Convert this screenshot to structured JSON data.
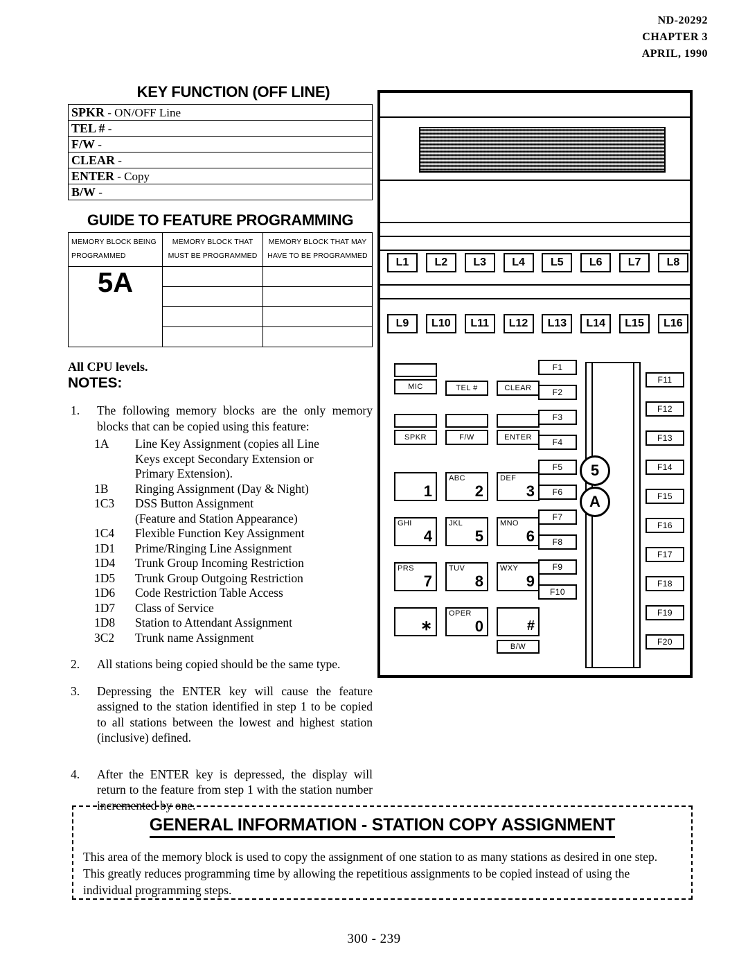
{
  "header": {
    "doc_id": "ND-20292",
    "chapter": "CHAPTER 3",
    "date": "APRIL, 1990"
  },
  "key_function": {
    "title": "KEY FUNCTION (OFF LINE)",
    "rows": [
      {
        "key": "SPKR",
        "value": "-  ON/OFF Line"
      },
      {
        "key": "TEL #",
        "value": "-"
      },
      {
        "key": "F/W",
        "value": "-"
      },
      {
        "key": "CLEAR",
        "value": "-"
      },
      {
        "key": "ENTER",
        "value": "- Copy"
      },
      {
        "key": "B/W",
        "value": "-"
      }
    ]
  },
  "guide": {
    "title": "GUIDE TO FEATURE PROGRAMMING",
    "headers": [
      {
        "line1": "MEMORY BLOCK BEING",
        "line2": "PROGRAMMED"
      },
      {
        "line1": "MEMORY BLOCK THAT",
        "line2": "MUST BE PROGRAMMED"
      },
      {
        "line1": "MEMORY BLOCK THAT MAY",
        "line2": "HAVE TO BE PROGRAMMED"
      }
    ],
    "memory_block": "5A",
    "empty_row_count": 4
  },
  "notes": {
    "cpu_levels": "All CPU levels.",
    "title": "NOTES:",
    "note1": {
      "num": "1.",
      "text": "The following memory blocks are the only memory blocks that can be copied using this feature:"
    },
    "memory_blocks": [
      {
        "code": "1A",
        "desc": "Line Key Assignment (copies all Line"
      },
      {
        "code": "",
        "desc": "Keys except Secondary Extension or"
      },
      {
        "code": "",
        "desc": "Primary Extension)."
      },
      {
        "code": "1B",
        "desc": "Ringing Assignment (Day & Night)"
      },
      {
        "code": "1C3",
        "desc": "DSS Button Assignment"
      },
      {
        "code": "",
        "desc": "(Feature and Station Appearance)"
      },
      {
        "code": "1C4",
        "desc": "Flexible Function Key Assignment"
      },
      {
        "code": "1D1",
        "desc": "Prime/Ringing Line Assignment"
      },
      {
        "code": "1D4",
        "desc": "Trunk Group Incoming Restriction"
      },
      {
        "code": "1D5",
        "desc": "Trunk Group Outgoing Restriction"
      },
      {
        "code": "1D6",
        "desc": "Code Restriction Table Access"
      },
      {
        "code": "1D7",
        "desc": "Class of Service"
      },
      {
        "code": "1D8",
        "desc": "Station to Attendant Assignment"
      },
      {
        "code": "3C2",
        "desc": "Trunk name Assignment"
      }
    ],
    "note2": {
      "num": "2.",
      "text": "All stations being copied should be the same type."
    },
    "note3": {
      "num": "3.",
      "text": "Depressing the ENTER key will cause the feature assigned to the station identified in step 1 to be copied to all stations between the lowest and highest station (inclusive) defined."
    },
    "note4": {
      "num": "4.",
      "text": "After the ENTER key is depressed, the display will return to the feature from step 1 with the station number incremented by one."
    }
  },
  "phone": {
    "line_keys_row1": [
      "L1",
      "L2",
      "L3",
      "L4",
      "L5",
      "L6",
      "L7",
      "L8"
    ],
    "line_keys_row2": [
      "L9",
      "L10",
      "L11",
      "L12",
      "L13",
      "L14",
      "L15",
      "L16"
    ],
    "function_keys": [
      {
        "label": "MIC",
        "has_blank_above": true
      },
      {
        "label": "TEL #",
        "has_blank_above": false
      },
      {
        "label": "CLEAR",
        "has_blank_above": false
      },
      {
        "label": "SPKR",
        "has_blank_above": true
      },
      {
        "label": "F/W",
        "has_blank_above": true
      },
      {
        "label": "ENTER",
        "has_blank_above": true
      }
    ],
    "digit_keys": [
      {
        "alpha": "",
        "num": "1"
      },
      {
        "alpha": "ABC",
        "num": "2"
      },
      {
        "alpha": "DEF",
        "num": "3"
      },
      {
        "alpha": "GHI",
        "num": "4"
      },
      {
        "alpha": "JKL",
        "num": "5"
      },
      {
        "alpha": "MNO",
        "num": "6"
      },
      {
        "alpha": "PRS",
        "num": "7"
      },
      {
        "alpha": "TUV",
        "num": "8"
      },
      {
        "alpha": "WXY",
        "num": "9"
      },
      {
        "alpha": "",
        "num": "∗"
      },
      {
        "alpha": "OPER",
        "num": "0"
      },
      {
        "alpha": "",
        "num": "#"
      }
    ],
    "bw_key": "B/W",
    "f_keys_left": [
      "F1",
      "F2",
      "F3",
      "F4",
      "F5",
      "F6",
      "F7",
      "F8",
      "F9",
      "F10"
    ],
    "f_keys_right": [
      "F11",
      "F12",
      "F13",
      "F14",
      "F15",
      "F16",
      "F17",
      "F18",
      "F19",
      "F20"
    ],
    "callouts": [
      "5",
      "A"
    ]
  },
  "general_info": {
    "title": "GENERAL INFORMATION  -  STATION COPY ASSIGNMENT",
    "body": "This area of the memory block is used to  copy  the assignment of one station to as many stations as desired in one step.  This greatly reduces programming time  by allowing the repetitious assignments to be copied instead of using the individual programming steps."
  },
  "footer": {
    "page_number": "300 - 239"
  }
}
